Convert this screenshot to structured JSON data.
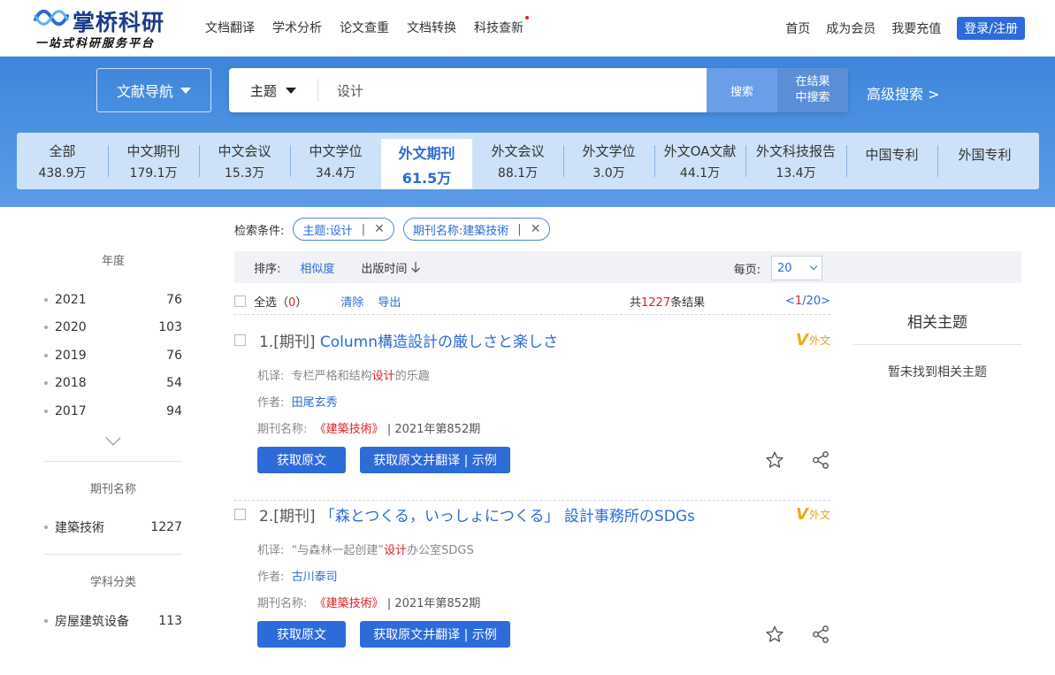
{
  "header": {
    "logo_name": "掌桥科研",
    "logo_slogan": "一站式科研服务平台",
    "nav": [
      "文档翻译",
      "学术分析",
      "论文查重",
      "文档转换",
      "科技查新"
    ],
    "right_links": [
      "首页",
      "成为会员",
      "我要充值"
    ],
    "login_label": "登录/注册"
  },
  "search": {
    "doc_nav_label": "文献导航",
    "field": "主题",
    "query": "设计",
    "search_btn": "搜索",
    "search_within_line1": "在结果",
    "search_within_line2": "中搜索",
    "advanced": "高级搜索 >"
  },
  "tabs": [
    {
      "label": "全部",
      "count": "438.9万"
    },
    {
      "label": "中文期刊",
      "count": "179.1万"
    },
    {
      "label": "中文会议",
      "count": "15.3万"
    },
    {
      "label": "中文学位",
      "count": "34.4万"
    },
    {
      "label": "外文期刊",
      "count": "61.5万"
    },
    {
      "label": "外文会议",
      "count": "88.1万"
    },
    {
      "label": "外文学位",
      "count": "3.0万"
    },
    {
      "label": "外文OA文献",
      "count": "44.1万"
    },
    {
      "label": "外文科技报告",
      "count": "13.4万"
    },
    {
      "label": "中国专利",
      "count": ""
    },
    {
      "label": "外国专利",
      "count": ""
    }
  ],
  "sidebar": {
    "year_title": "年度",
    "years": [
      {
        "label": "2021",
        "count": "76"
      },
      {
        "label": "2020",
        "count": "103"
      },
      {
        "label": "2019",
        "count": "76"
      },
      {
        "label": "2018",
        "count": "54"
      },
      {
        "label": "2017",
        "count": "94"
      }
    ],
    "journal_title": "期刊名称",
    "journals": [
      {
        "label": "建築技術",
        "count": "1227"
      }
    ],
    "subject_title": "学科分类",
    "subjects": [
      {
        "label": "房屋建筑设备",
        "count": "113"
      }
    ]
  },
  "conditions": {
    "label": "检索条件:",
    "chips": [
      "主题:设计",
      "期刊名称:建築技術"
    ]
  },
  "sortbar": {
    "label": "排序:",
    "similarity": "相似度",
    "pubtime": "出版时间",
    "per_page_label": "每页:",
    "per_page": "20"
  },
  "selbar": {
    "select_all": "全选",
    "selected_open": "（",
    "selected_count": "0",
    "selected_close": "）",
    "clear": "清除",
    "export": "导出",
    "total_prefix": "共",
    "total": "1227",
    "total_suffix": "条结果",
    "page_prev": "<",
    "page_current": "1",
    "page_total": "/20>"
  },
  "results": [
    {
      "index": "1.[期刊]",
      "title": "Column構造設計の厳しさと楽しさ",
      "badge": "外文",
      "trans_label": "机译:",
      "trans_a": "专栏严格和结构",
      "trans_hl": "设计",
      "trans_b": "的乐趣",
      "author_label": "作者:",
      "author": "田尾玄秀",
      "journal_label": "期刊名称:",
      "journal": "《建築技術》",
      "issue": "| 2021年第852期",
      "btn1": "获取原文",
      "btn2": "获取原文并翻译 | 示例"
    },
    {
      "index": "2.[期刊]",
      "title": "「森とつくる，いっしょにつくる」 設計事務所のSDGs",
      "badge": "外文",
      "trans_label": "机译:",
      "trans_a": "“与森林一起创建”",
      "trans_hl": "设计",
      "trans_b": "办公室SDGS",
      "author_label": "作者:",
      "author": "古川泰司",
      "journal_label": "期刊名称:",
      "journal": "《建築技術》",
      "issue": "| 2021年第852期",
      "btn1": "获取原文",
      "btn2": "获取原文并翻译 | 示例"
    }
  ],
  "related": {
    "title": "相关主题",
    "empty": "暂未找到相关主题"
  },
  "colors": {
    "primary": "#2d6bd9",
    "banner": "#4a8fe0",
    "highlight": "#e02020",
    "badge": "#f0a818"
  }
}
